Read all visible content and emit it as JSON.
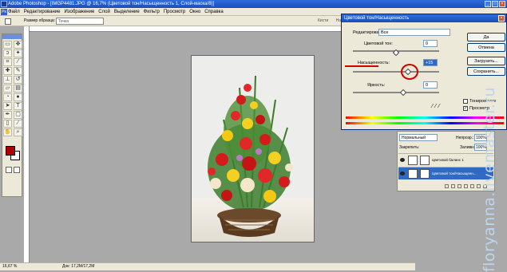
{
  "window": {
    "title": "Adobe Photoshop - [IMGP4481.JPG @ 16,7% (Цветовой тон/Насыщенность 1, Слой-маска/8)]",
    "icon": "photoshop-icon"
  },
  "menu": {
    "items": [
      "Файл",
      "Редактирование",
      "Изображение",
      "Слой",
      "Выделение",
      "Фильтр",
      "Просмотр",
      "Окно",
      "Справка"
    ]
  },
  "options": {
    "sample_label": "Размер образца:",
    "sample_value": "Точка",
    "tabs": [
      "Кисти",
      "Наборы"
    ]
  },
  "status": {
    "zoom": "16,67 %",
    "doc": "Док: 17,2M/17,2M"
  },
  "dialog": {
    "title": "Цветовой тон/Насыщенность",
    "edit_label": "Редактировать:",
    "edit_value": "Все",
    "hue_label": "Цветовой тон:",
    "hue_value": "0",
    "sat_label": "Насыщенность:",
    "sat_value": "+15",
    "light_label": "Яркость:",
    "light_value": "0",
    "buttons": {
      "ok": "Да",
      "cancel": "Отмена",
      "load": "Загрузить...",
      "save": "Сохранить..."
    },
    "colorize_label": "Тонирование",
    "colorize_checked": false,
    "preview_label": "Просмотр",
    "preview_checked": true
  },
  "layers": {
    "blend_mode": "Нормальный",
    "opacity_label": "Непрозр.:",
    "opacity_value": "100%",
    "lock_label": "Закрепить:",
    "fill_label": "Заливка:",
    "fill_value": "100%",
    "rows": [
      {
        "name": "Цветовой баланс 1",
        "active": false
      },
      {
        "name": "Цветовой тон/Насыщенн...",
        "active": true
      }
    ]
  },
  "watermark": {
    "text": "floryanna.livemaster.ru"
  },
  "colors": {
    "foreground": "#b00000",
    "background": "#ffffff",
    "accent": "#316ac5",
    "annotation": "#d10000"
  }
}
